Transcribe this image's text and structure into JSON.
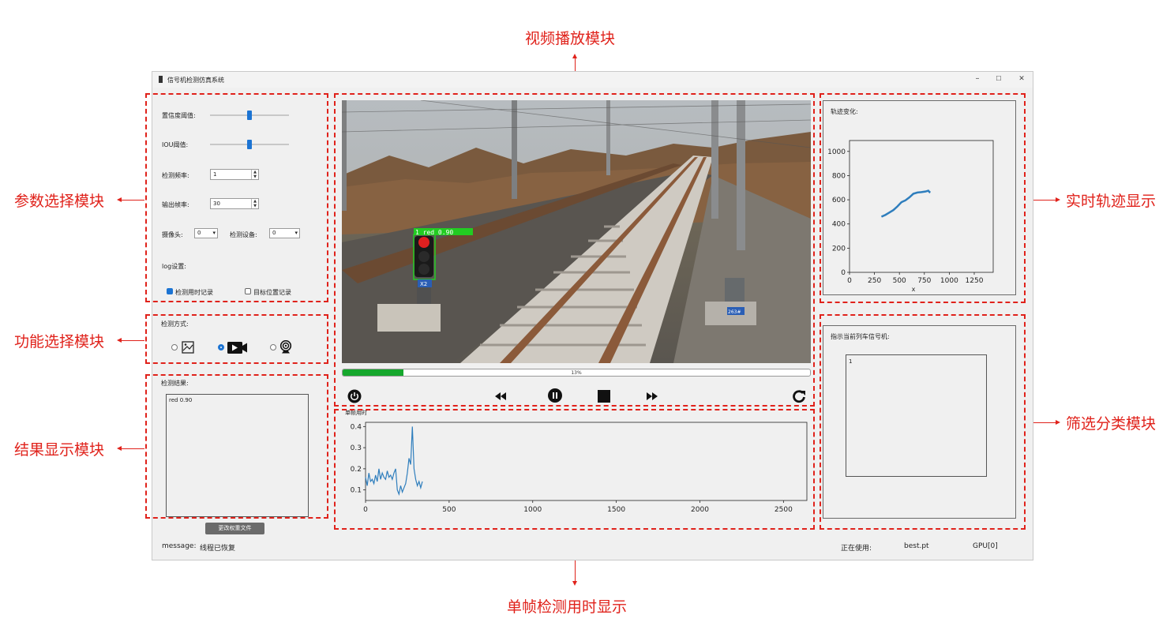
{
  "annotations": {
    "video_module": "视频播放模块",
    "param_module": "参数选择模块",
    "function_module": "功能选择模块",
    "result_module": "结果显示模块",
    "trajectory_module": "实时轨迹显示",
    "filter_module": "筛选分类模块",
    "frame_time_module": "单帧检测用时显示"
  },
  "window": {
    "title": "信号机检测仿真系统",
    "minimize": "–",
    "maximize": "☐",
    "close": "✕"
  },
  "params": {
    "confidence_label": "置信度阈值:",
    "confidence_value": 0.5,
    "iou_label": "IOU阈值:",
    "iou_value": 0.5,
    "detect_rate_label": "检测频率:",
    "detect_rate_value": "1",
    "output_fps_label": "输出帧率:",
    "output_fps_value": "30",
    "camera_label": "摄像头:",
    "camera_value": "0",
    "device_label": "检测设备:",
    "device_value": "0",
    "log_label": "log设置:",
    "log_time_label": "检测用时记录",
    "log_time_checked": true,
    "log_pos_label": "目标位置记录",
    "log_pos_checked": false
  },
  "function": {
    "label": "检测方式:",
    "mode_selected": "video"
  },
  "result": {
    "label": "检测结果:",
    "text": "red 0.90"
  },
  "weights_button": "更改权重文件",
  "status": {
    "message_label": "message:",
    "message_value": "线程已恢复",
    "using_label": "正在使用:",
    "model": "best.pt",
    "gpu": "GPU[0]"
  },
  "video": {
    "detection_label": "1 red 0.90",
    "signal_plate": "X2",
    "box_plate": "263#",
    "progress_pct": 13,
    "progress_text": "13%"
  },
  "trajectory": {
    "label": "轨迹变化:",
    "xlabel": "x",
    "chart_data": {
      "type": "line",
      "x": [
        320,
        360,
        400,
        440,
        480,
        520,
        560,
        600,
        640,
        680,
        720,
        760,
        790,
        800,
        810
      ],
      "y": [
        460,
        475,
        495,
        515,
        545,
        580,
        595,
        620,
        650,
        660,
        663,
        668,
        675,
        665,
        660
      ],
      "xticks": [
        "0",
        "250",
        "500",
        "750",
        "1000",
        "1250"
      ],
      "yticks": [
        "0",
        "200",
        "400",
        "600",
        "800",
        "1000"
      ],
      "xlim": [
        0,
        1440
      ],
      "ylim": [
        0,
        1090
      ]
    }
  },
  "filter": {
    "label": "指示当前列车信号机:",
    "value": "1"
  },
  "frametime": {
    "label": "单帧用时",
    "chart_data": {
      "type": "line",
      "xticks": [
        "0",
        "500",
        "1000",
        "1500",
        "2000",
        "2500"
      ],
      "yticks": [
        "0.1",
        "0.2",
        "0.3",
        "0.4"
      ],
      "xlim": [
        0,
        2640
      ],
      "ylim": [
        0.05,
        0.42
      ],
      "x": [
        0,
        10,
        20,
        30,
        40,
        50,
        60,
        70,
        80,
        90,
        100,
        110,
        120,
        130,
        140,
        150,
        160,
        170,
        180,
        190,
        200,
        210,
        220,
        230,
        240,
        250,
        260,
        270,
        280,
        290,
        300,
        310,
        320,
        330,
        340
      ],
      "y": [
        0.16,
        0.12,
        0.18,
        0.14,
        0.15,
        0.13,
        0.17,
        0.14,
        0.2,
        0.15,
        0.18,
        0.16,
        0.15,
        0.19,
        0.16,
        0.17,
        0.15,
        0.18,
        0.2,
        0.1,
        0.08,
        0.12,
        0.09,
        0.11,
        0.13,
        0.18,
        0.25,
        0.22,
        0.4,
        0.2,
        0.15,
        0.12,
        0.14,
        0.11,
        0.14
      ]
    }
  }
}
